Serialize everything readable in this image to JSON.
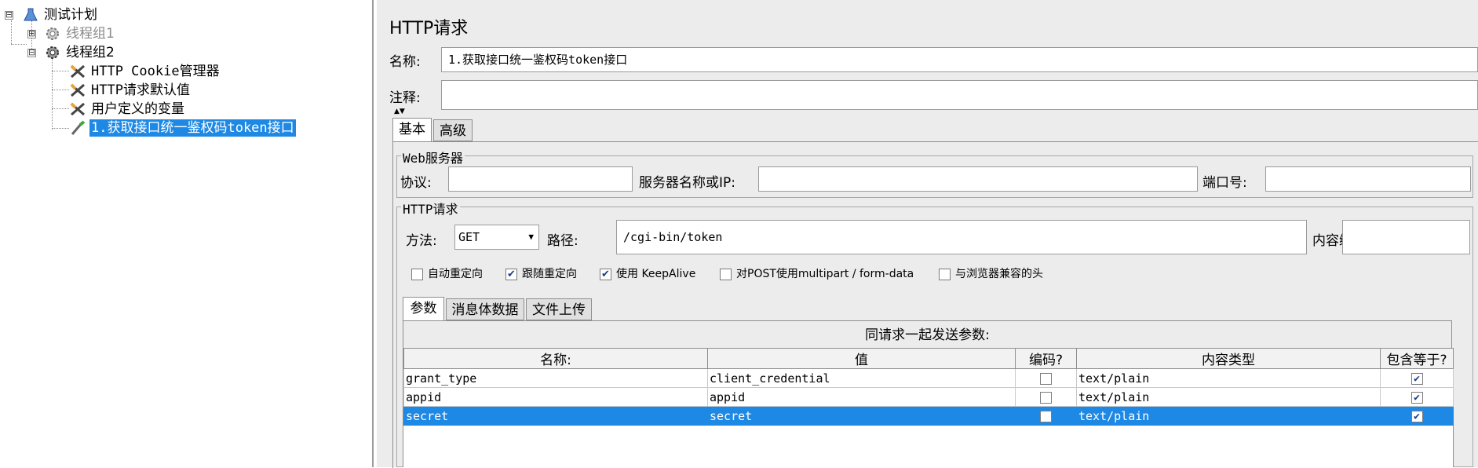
{
  "tree": {
    "root": {
      "label": "测试计划",
      "expander": "⊟"
    },
    "items": [
      {
        "label": "线程组1",
        "expander": "⊞",
        "icon": "gear-icon",
        "disabled": true
      },
      {
        "label": "线程组2",
        "expander": "⊟",
        "icon": "gear-icon"
      },
      {
        "label": "HTTP Cookie管理器",
        "icon": "wrench-icon"
      },
      {
        "label": "HTTP请求默认值",
        "icon": "wrench-icon"
      },
      {
        "label": "用户定义的变量",
        "icon": "wrench-icon"
      },
      {
        "label": "1.获取接口统一鉴权码token接口",
        "icon": "pipette-icon",
        "selected": true
      }
    ]
  },
  "panel": {
    "title": "HTTP请求",
    "name_label": "名称:",
    "name_value": "1.获取接口统一鉴权码token接口",
    "comment_label": "注释:",
    "comment_value": "",
    "tabs": [
      "基本",
      "高级"
    ],
    "web_server": {
      "legend": "Web服务器",
      "protocol_label": "协议:",
      "protocol_value": "",
      "server_label": "服务器名称或IP:",
      "server_value": "",
      "port_label": "端口号:",
      "port_value": ""
    },
    "http_request": {
      "legend": "HTTP请求",
      "method_label": "方法:",
      "method_value": "GET",
      "path_label": "路径:",
      "path_value": "/cgi-bin/token",
      "encoding_label": "内容编码:",
      "encoding_value": ""
    },
    "options": [
      {
        "label": "自动重定向",
        "checked": false
      },
      {
        "label": "跟随重定向",
        "checked": true
      },
      {
        "label": "使用 KeepAlive",
        "checked": true
      },
      {
        "label": "对POST使用multipart / form-data",
        "checked": false
      },
      {
        "label": "与浏览器兼容的头",
        "checked": false
      }
    ],
    "sub_tabs": [
      "参数",
      "消息体数据",
      "文件上传"
    ],
    "params_caption": "同请求一起发送参数:",
    "columns": [
      "名称:",
      "值",
      "编码?",
      "内容类型",
      "包含等于?"
    ],
    "rows": [
      {
        "name": "grant_type",
        "value": "client_credential",
        "encode": false,
        "content_type": "text/plain",
        "include_equals": true
      },
      {
        "name": "appid",
        "value": "appid",
        "encode": false,
        "content_type": "text/plain",
        "include_equals": true
      },
      {
        "name": "secret",
        "value": "secret",
        "encode": false,
        "content_type": "text/plain",
        "include_equals": true,
        "selected": true
      }
    ]
  },
  "colors": {
    "selection": "#1e88e5",
    "panel_bg": "#ececec"
  }
}
